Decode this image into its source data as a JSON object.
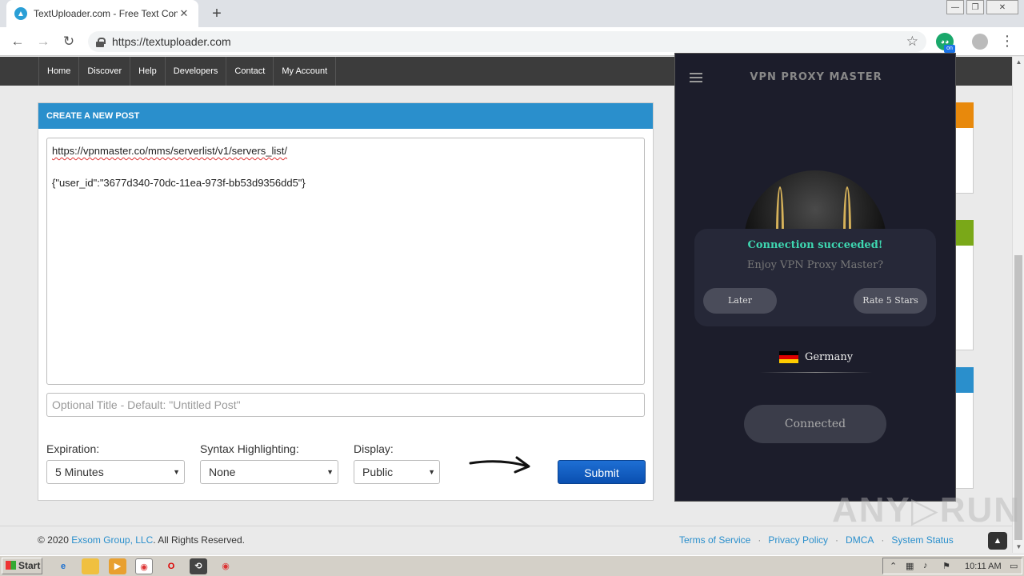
{
  "browser": {
    "tab_title": "TextUploader.com - Free Text Conte",
    "tab_close": "✕",
    "new_tab": "+",
    "url": "https://textuploader.com",
    "ext_label": "on",
    "win_min": "—",
    "win_max": "❐",
    "win_close": "✕"
  },
  "site_nav": [
    "Home",
    "Discover",
    "Help",
    "Developers",
    "Contact",
    "My Account"
  ],
  "post_form": {
    "heading": "CREATE A NEW POST",
    "body_line1": "https://vpnmaster.co/mms/serverlist/v1/servers_list/",
    "body_line2": "",
    "body_line3": "{\"user_id\":\"3677d340-70dc-11ea-973f-bb53d9356dd5\"}",
    "title_placeholder": "Optional Title - Default: \"Untitled Post\"",
    "expiration_label": "Expiration:",
    "expiration_value": "5 Minutes",
    "syntax_label": "Syntax Highlighting:",
    "syntax_value": "None",
    "display_label": "Display:",
    "display_value": "Public",
    "submit_label": "Submit"
  },
  "footer": {
    "copyright_prefix": "© 2020 ",
    "company": "Exsom Group, LLC",
    "copyright_suffix": ". All Rights Reserved.",
    "links": [
      "Terms of Service",
      "Privacy Policy",
      "DMCA",
      "System Status"
    ],
    "separator": "·"
  },
  "vpn_popup": {
    "brand": "VPN PROXY MASTER",
    "status_message": "Connection succeeded!",
    "prompt": "Enjoy VPN Proxy Master?",
    "later_label": "Later",
    "rate_label": "Rate 5 Stars",
    "country": "Germany",
    "connect_state": "Connected"
  },
  "watermark": "ANY▷RUN",
  "taskbar": {
    "start_label": "Start",
    "clock": "10:11 AM"
  },
  "colors": {
    "accent_blue": "#2a8fcc",
    "vpn_bg": "#1c1d2b",
    "success_teal": "#3ed6b0",
    "submit_blue": "#0a4fb0"
  }
}
